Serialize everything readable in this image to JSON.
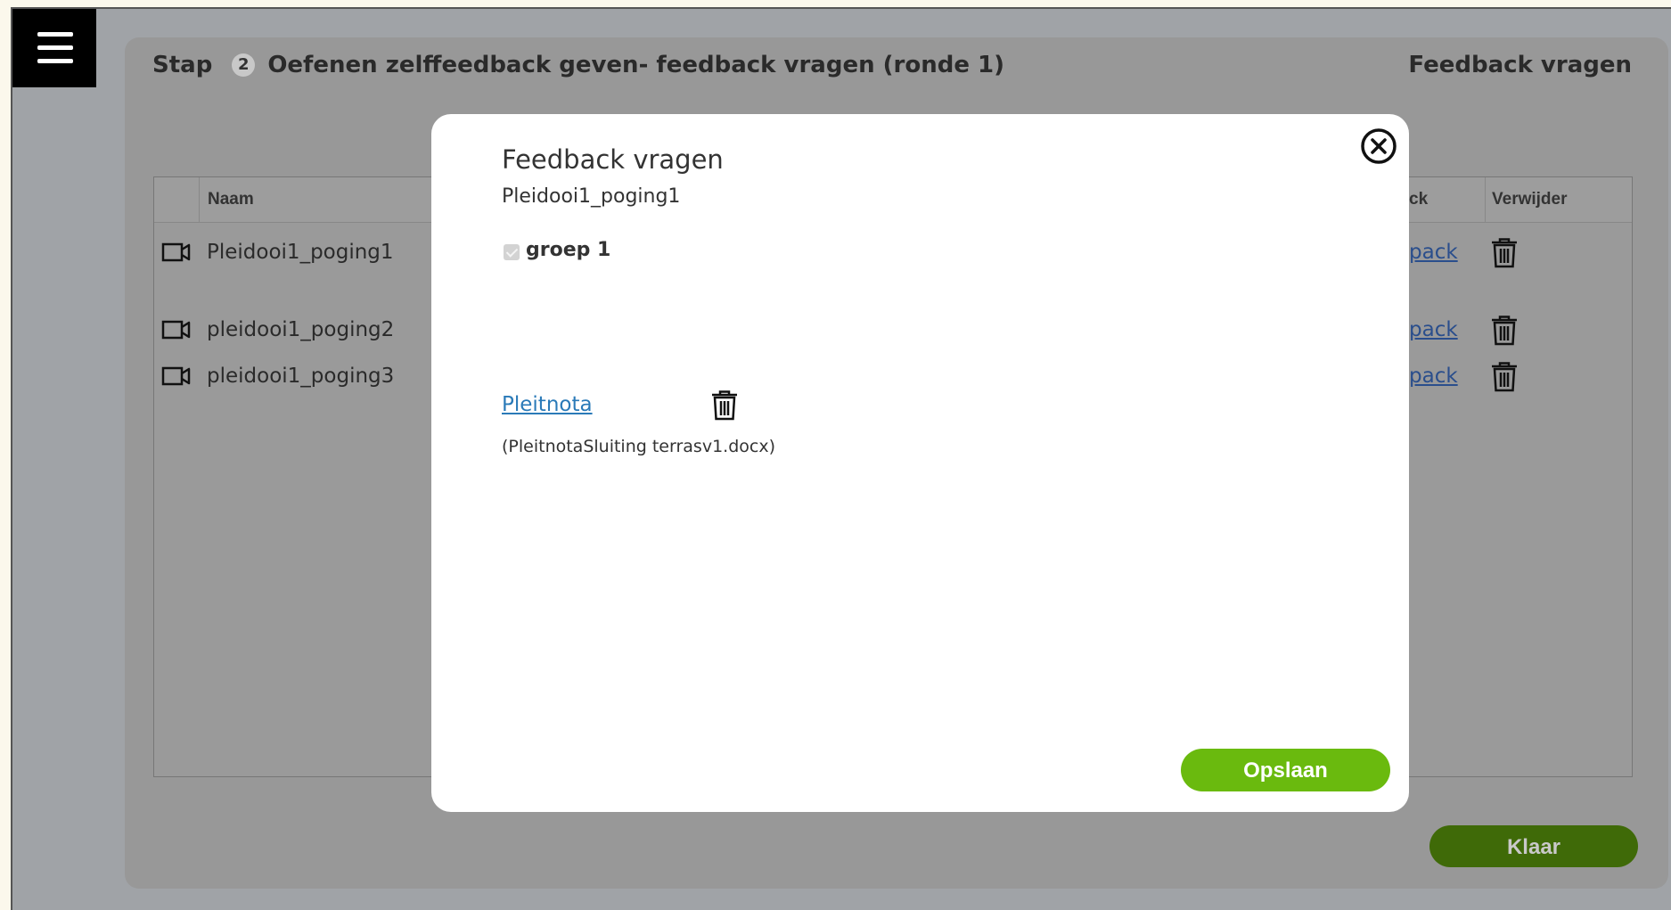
{
  "header": {
    "step_label": "Stap",
    "step_number": "2",
    "step_title": "Oefenen zelffeedback geven- feedback vragen (ronde 1)",
    "right_title": "Feedback vragen"
  },
  "table": {
    "columns": [
      "Naam",
      "ck",
      "Verwijder"
    ],
    "rows": [
      {
        "name": "Pleidooi1_poging1",
        "feedback_link": "pack"
      },
      {
        "name": "pleidooi1_poging2",
        "feedback_link": "pack"
      },
      {
        "name": "pleidooi1_poging3",
        "feedback_link": "pack"
      }
    ]
  },
  "footer": {
    "done_label": "Klaar"
  },
  "modal": {
    "title": "Feedback vragen",
    "subtitle": "Pleidooi1_poging1",
    "group_label": "groep 1",
    "group_checked": true,
    "document_link": "Pleitnota",
    "document_file": "(PleitnotaSluiting terrasv1.docx)",
    "save_label": "Opslaan"
  },
  "colors": {
    "save_button": "#6aba0e",
    "done_button": "#3f6a08",
    "link": "#2a7ab8",
    "overlay": "#a0a3a7"
  },
  "icons": [
    "menu-icon",
    "video-camera-icon",
    "trash-icon",
    "close-circle-icon"
  ]
}
